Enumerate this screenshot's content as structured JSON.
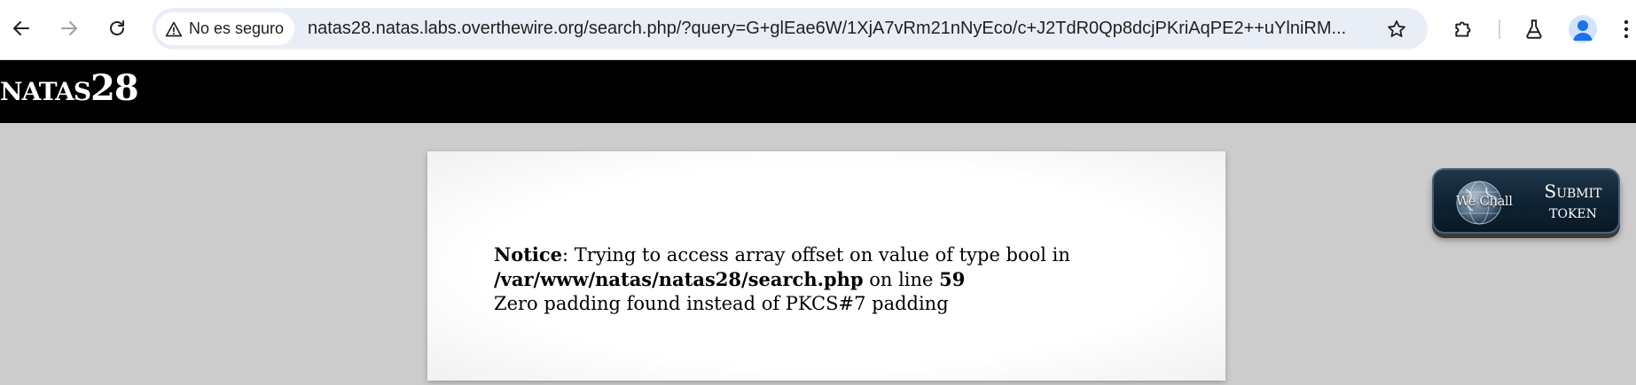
{
  "browser": {
    "back_icon": "arrow-left-icon",
    "forward_icon": "arrow-right-icon",
    "reload_icon": "reload-icon",
    "security_label": "No es seguro",
    "security_icon": "warning-triangle-icon",
    "url": "natas28.natas.labs.overthewire.org/search.php/?query=G+glEae6W/1XjA7vRm21nNyEco/c+J2TdR0Qp8dcjPKriAqPE2++uYlniRM...",
    "bookmark_icon": "star-outline-icon",
    "extensions_icon": "puzzle-piece-icon",
    "labs_icon": "flask-icon",
    "profile_icon": "person-avatar-icon",
    "accent_color": "#1a73e8"
  },
  "page": {
    "site_title": "natas28",
    "notice": {
      "label": "Notice",
      "message": ": Trying to access array offset on value of type bool in",
      "file_path": "/var/www/natas/natas28/search.php",
      "on_line_text": " on line ",
      "line_number": "59",
      "padding_message": "Zero padding found instead of PKCS#7 padding"
    },
    "submit_token": {
      "brand": "We Chall",
      "line1": "Submit",
      "line2": "token"
    }
  }
}
